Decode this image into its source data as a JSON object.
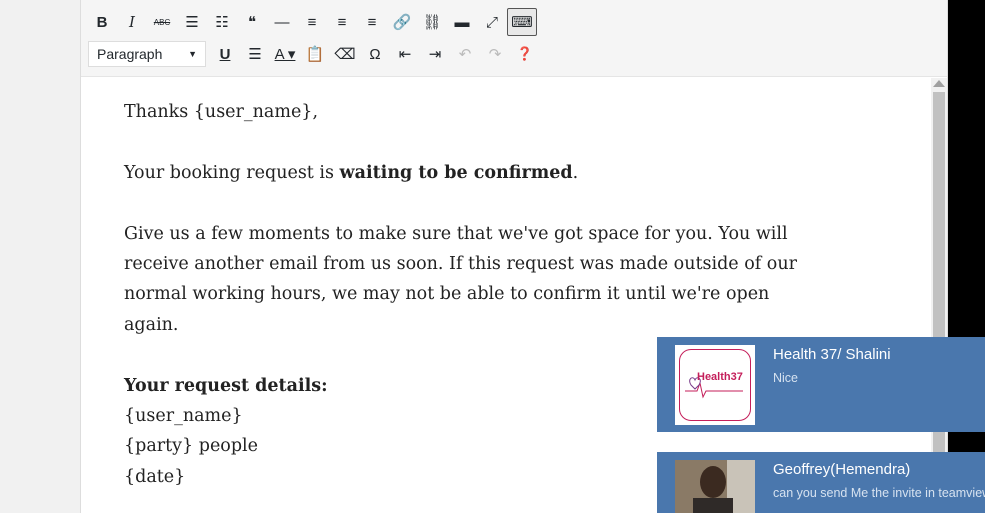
{
  "toolbar": {
    "row1": [
      {
        "name": "bold-button",
        "glyph": "B"
      },
      {
        "name": "italic-button",
        "glyph": "I"
      },
      {
        "name": "strikethrough-button",
        "glyph": "ABC"
      },
      {
        "name": "bulleted-list-button",
        "glyph": "☰"
      },
      {
        "name": "numbered-list-button",
        "glyph": "☷"
      },
      {
        "name": "blockquote-button",
        "glyph": "❝"
      },
      {
        "name": "horizontal-line-button",
        "glyph": "—"
      },
      {
        "name": "align-left-button",
        "glyph": "≡"
      },
      {
        "name": "align-center-button",
        "glyph": "≡"
      },
      {
        "name": "align-right-button",
        "glyph": "≡"
      },
      {
        "name": "insert-link-button",
        "glyph": "🔗"
      },
      {
        "name": "remove-link-button",
        "glyph": "⛓"
      },
      {
        "name": "read-more-button",
        "glyph": "▬"
      },
      {
        "name": "fullscreen-button",
        "glyph": "⤢"
      },
      {
        "name": "toolbar-toggle-button",
        "glyph": "⌨"
      }
    ],
    "paragraph_select": "Paragraph",
    "row2": [
      {
        "name": "underline-button",
        "glyph": "U"
      },
      {
        "name": "justify-button",
        "glyph": "☰"
      },
      {
        "name": "text-color-button",
        "glyph": "A ▾"
      },
      {
        "name": "paste-as-text-button",
        "glyph": "📋"
      },
      {
        "name": "clear-formatting-button",
        "glyph": "⌫"
      },
      {
        "name": "special-character-button",
        "glyph": "Ω"
      },
      {
        "name": "decrease-indent-button",
        "glyph": "⇤"
      },
      {
        "name": "increase-indent-button",
        "glyph": "⇥"
      },
      {
        "name": "undo-button",
        "glyph": "↶"
      },
      {
        "name": "redo-button",
        "glyph": "↷"
      },
      {
        "name": "help-button",
        "glyph": "❓"
      }
    ]
  },
  "content": {
    "greeting": "Thanks {user_name},",
    "line2_prefix": "Your booking request is ",
    "line2_bold": "waiting to be confirmed",
    "line2_suffix": ".",
    "paragraph": "Give us a few moments to make sure that we've got space for you. You will receive another email from us soon. If this request was made outside of our normal working hours, we may not be able to confirm it until we're open again.",
    "details_heading": "Your request details:",
    "details": [
      "{user_name}",
      "{party} people",
      "{date}"
    ]
  },
  "notifications": [
    {
      "title": "Health 37/ Shalini",
      "message": "Nice",
      "logo_text": "Health37"
    },
    {
      "title": "Geoffrey(Hemendra)",
      "message": "can you send Me the invite in teamviewer"
    }
  ]
}
